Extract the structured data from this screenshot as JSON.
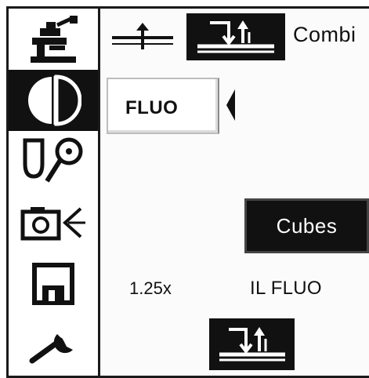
{
  "sidebar": {
    "items": [
      {
        "icon": "microscope-stand-icon",
        "active": false
      },
      {
        "icon": "illumination-lens-icon",
        "active": true
      },
      {
        "icon": "objective-magnifier-icon",
        "active": false
      },
      {
        "icon": "camera-icon",
        "active": false
      },
      {
        "icon": "save-icon",
        "active": false
      },
      {
        "icon": "wrench-icon",
        "active": false
      }
    ]
  },
  "toolbar": {
    "transmitted_light_icon": "transmitted-light-icon",
    "combi_mode_icon": "combi-mode-icon",
    "combi_label": "Combi"
  },
  "fluo_selector": {
    "value": "FLUO"
  },
  "cubes_button": {
    "label": "Cubes"
  },
  "status": {
    "magnification": "1.25x",
    "mode": "IL FLUO"
  },
  "colors": {
    "ink": "#111111",
    "panel": "#ffffff",
    "border": "#1a1a1a"
  }
}
